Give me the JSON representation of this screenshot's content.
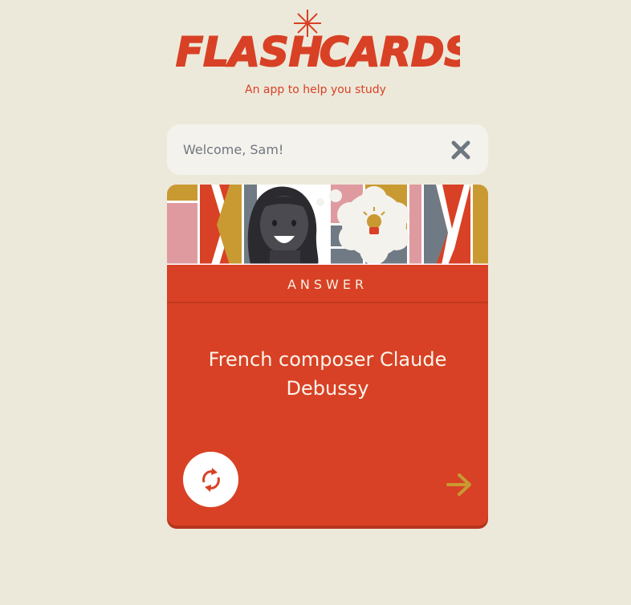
{
  "app": {
    "title_part1": "FLASH",
    "title_part2": "CARDS",
    "subtitle": "An app to help you study"
  },
  "welcome": {
    "text": "Welcome, Sam!"
  },
  "card": {
    "side_label": "ANSWER",
    "content": "French composer Claude Debussy"
  },
  "icons": {
    "close": "close-icon",
    "flip": "flip-icon",
    "next": "arrow-right-icon"
  },
  "colors": {
    "background": "#ede9da",
    "accent_red": "#d84125",
    "mustard": "#c99a32",
    "pink": "#df9aa0",
    "slate": "#707a84",
    "input_bg": "#f4f2ec"
  }
}
